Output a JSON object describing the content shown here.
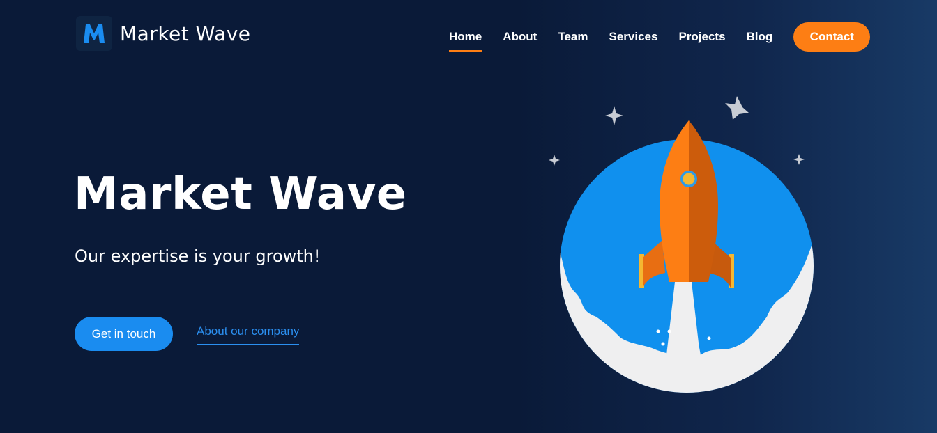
{
  "brand": {
    "name": "Market Wave",
    "logo_letter": "M",
    "logo_color": "#1a8cf0"
  },
  "nav": {
    "items": [
      {
        "label": "Home",
        "active": true
      },
      {
        "label": "About",
        "active": false
      },
      {
        "label": "Team",
        "active": false
      },
      {
        "label": "Services",
        "active": false
      },
      {
        "label": "Projects",
        "active": false
      },
      {
        "label": "Blog",
        "active": false
      }
    ],
    "contact_label": "Contact"
  },
  "hero": {
    "title": "Market Wave",
    "subtitle": "Our expertise is your growth!",
    "primary_cta": "Get in touch",
    "secondary_link": "About our company"
  },
  "colors": {
    "accent": "#fd7e14",
    "primary": "#1a8cf0",
    "background": "#0a1a38"
  },
  "illustration": {
    "icon": "rocket-launch-icon"
  }
}
